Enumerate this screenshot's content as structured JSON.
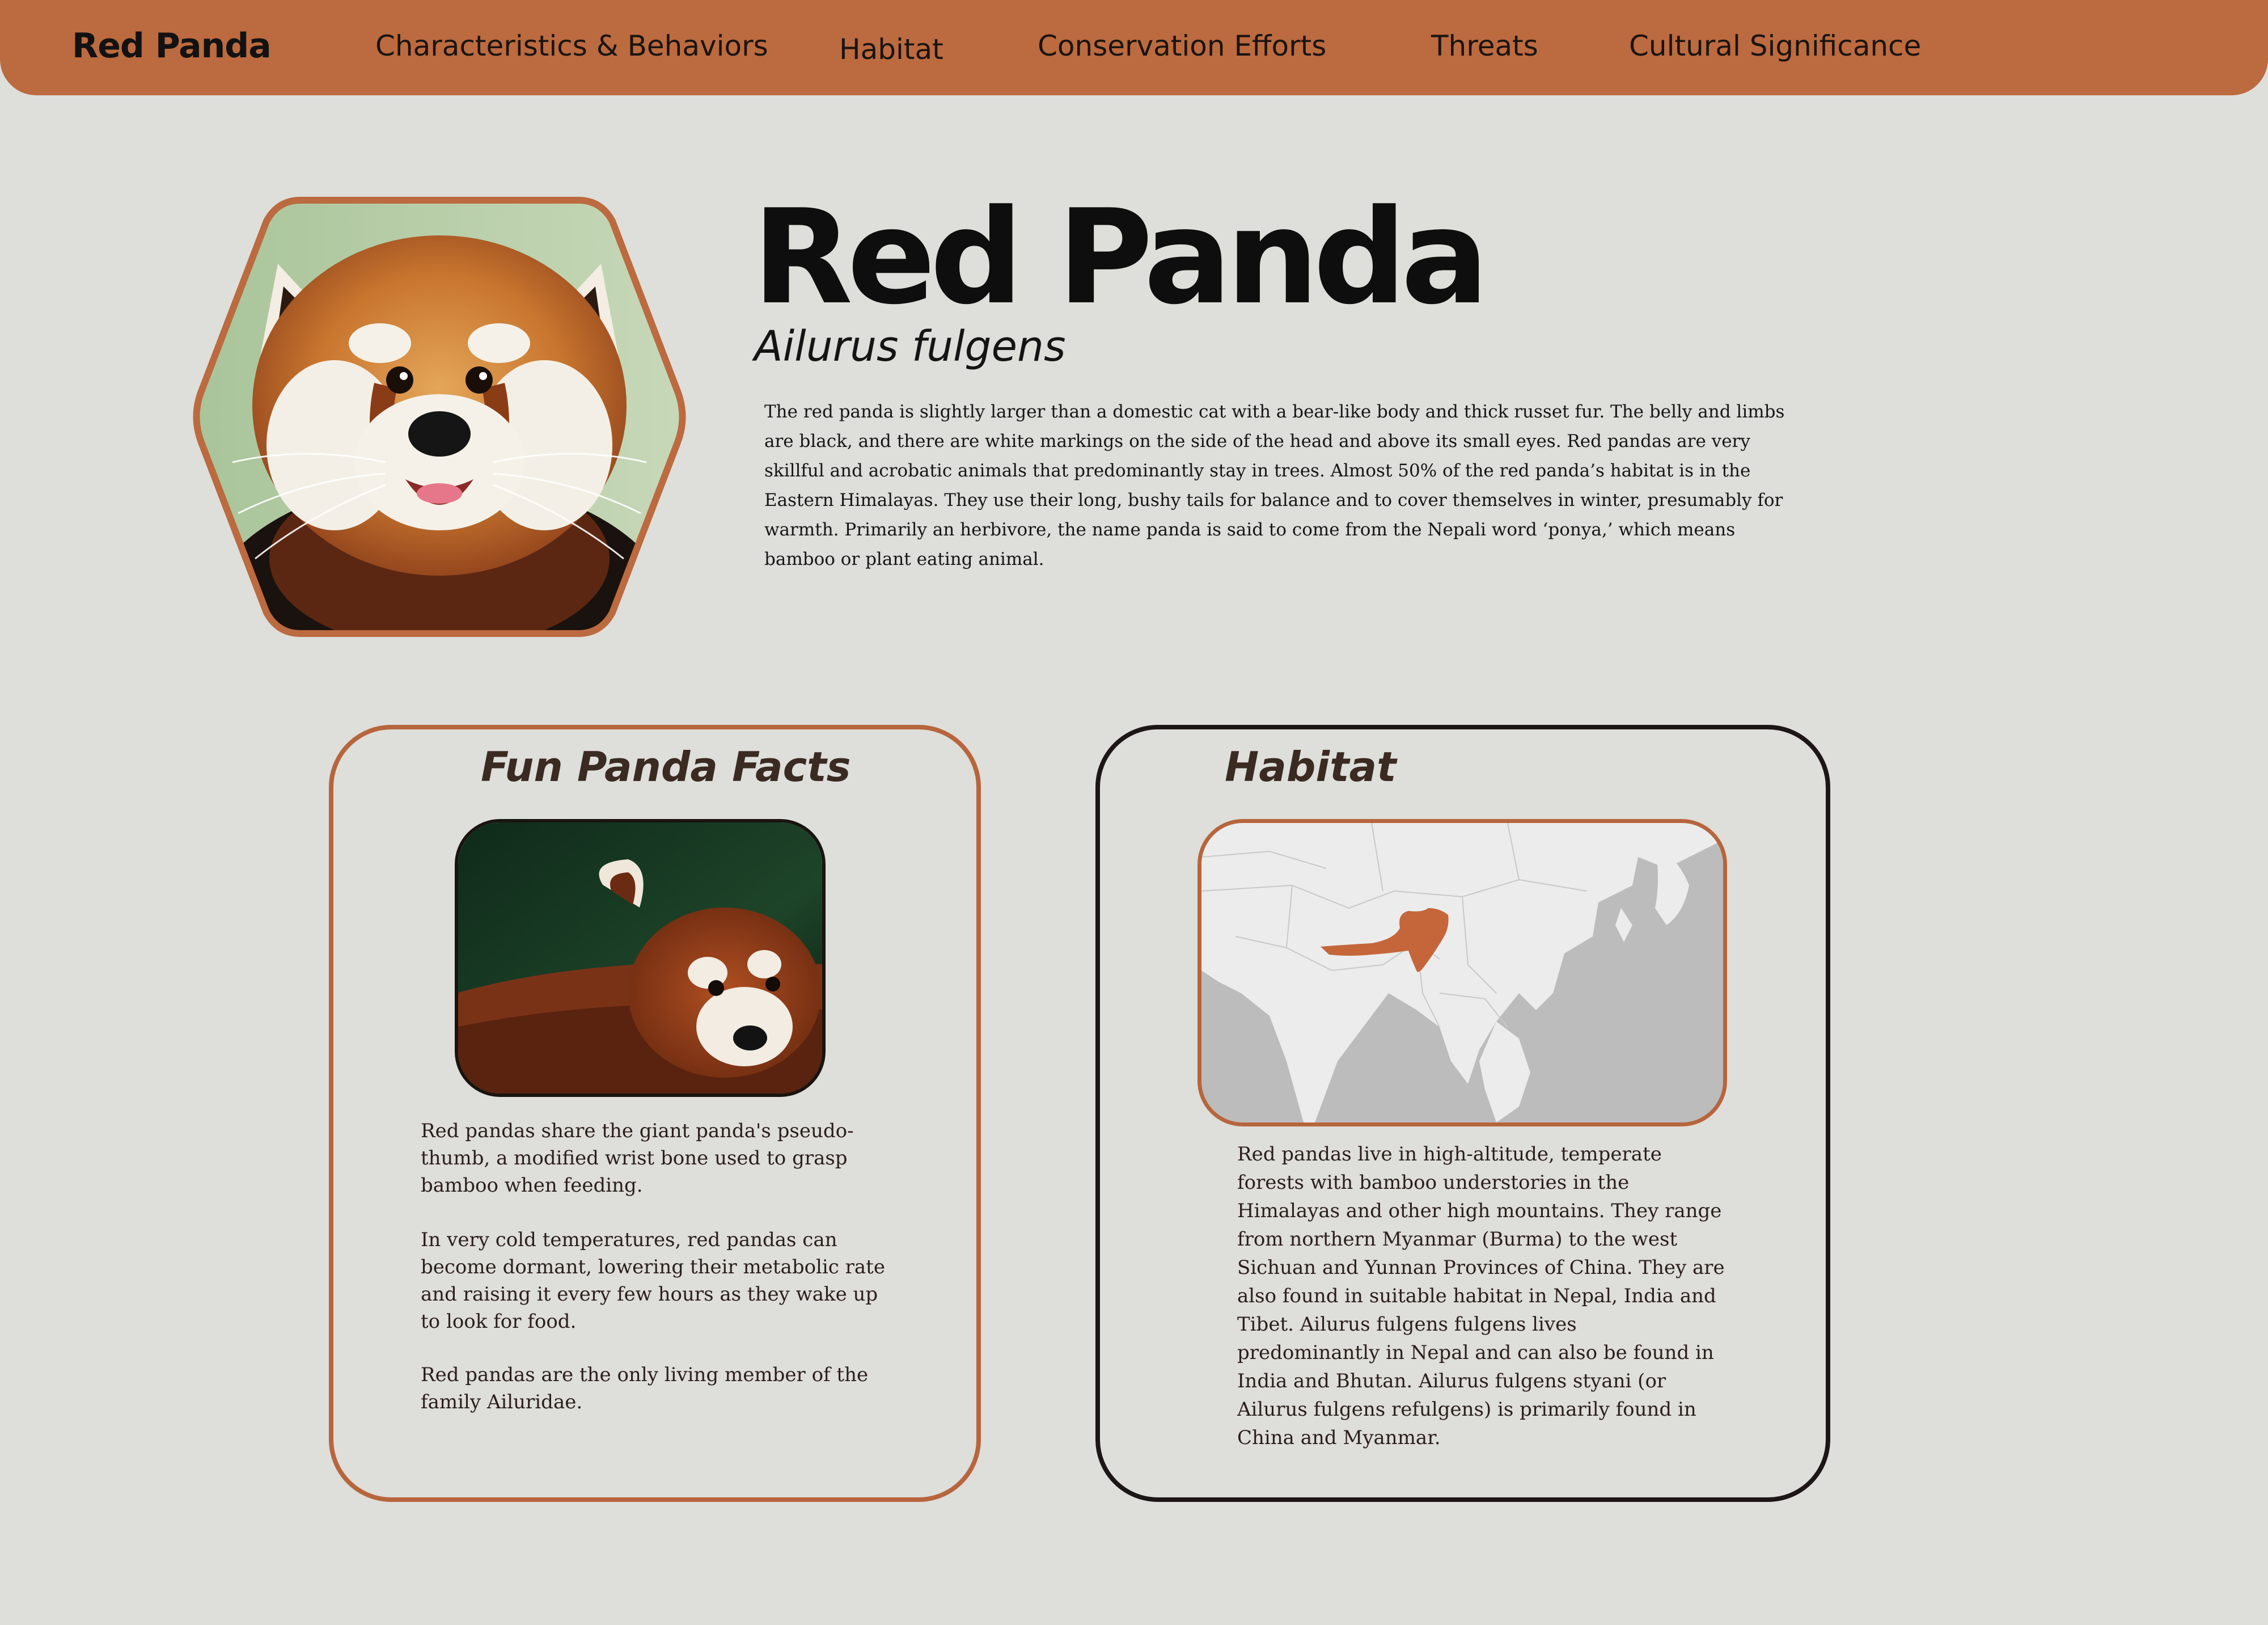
{
  "nav": {
    "brand": "Red Panda",
    "links": [
      "Characteristics & Behaviors",
      "Habitat",
      "Conservation Efforts",
      "Threats",
      "Cultural Significance"
    ]
  },
  "hero": {
    "title": "Red Panda",
    "subtitle": "Ailurus fulgens",
    "description": "The red panda is slightly larger than a domestic cat with a bear-like body and thick russet fur. The belly and limbs are black, and there are white markings on the side of the head and above its small eyes. Red pandas are very skillful and acrobatic animals that predominantly stay in trees. Almost 50% of the red panda’s habitat is in the Eastern Himalayas. They use their long, bushy tails for balance and to cover themselves in winter, presumably for warmth. Primarily an herbivore, the name panda is said to come from the Nepali word ‘ponya,’ which means bamboo or plant eating animal."
  },
  "facts": {
    "title": "Fun Panda Facts",
    "items": [
      "Red pandas share the giant panda's pseudo-thumb, a modified wrist bone used to grasp bamboo when feeding.",
      "In very cold temperatures, red pandas can become dormant, lowering their metabolic rate and raising it every few hours as they wake up to look for food.",
      "Red pandas are the only living member of the family Ailuridae."
    ]
  },
  "habitat": {
    "title": "Habitat",
    "text": "Red pandas live in high-altitude, temperate forests with bamboo understories in the Himalayas and other high mountains. They range from northern Myanmar (Burma) to the west Sichuan and Yunnan Provinces of China. They are also found in suitable habitat in Nepal, India and Tibet. Ailurus fulgens fulgens lives predominantly in Nepal and can also be found in India and Bhutan. Ailurus fulgens styani (or Ailurus fulgens refulgens) is primarily found in China and Myanmar."
  },
  "colors": {
    "accent": "#bc6a3f",
    "background": "#dededa",
    "range": "#c4663a"
  }
}
